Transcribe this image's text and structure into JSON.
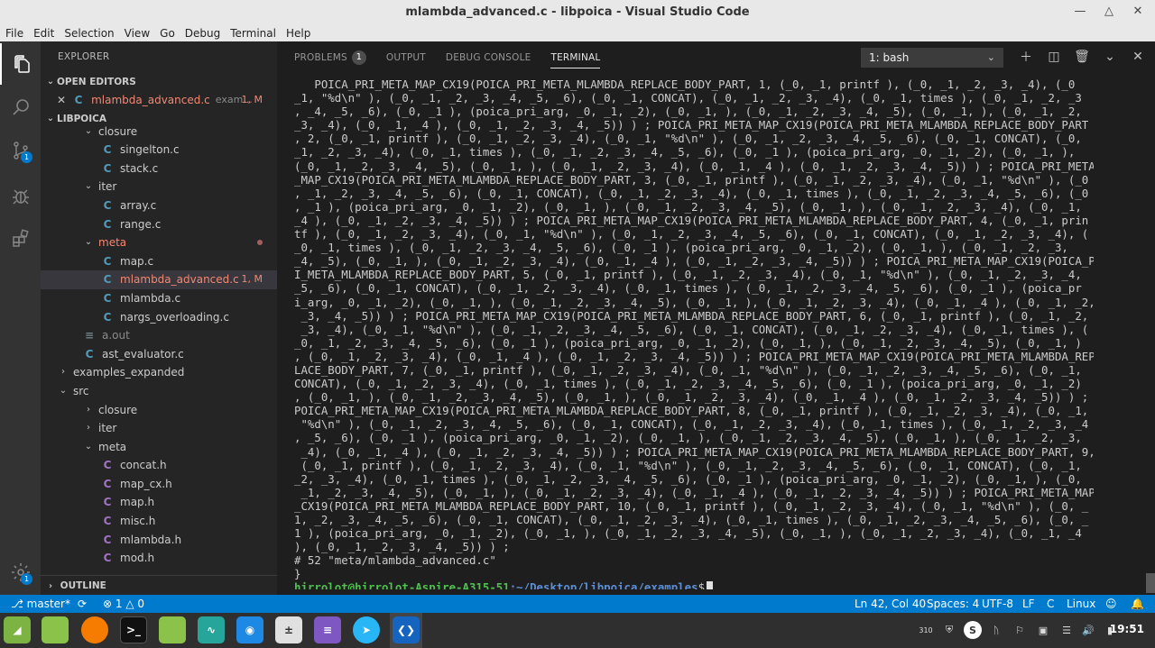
{
  "window": {
    "title": "mlambda_advanced.c - libpoica - Visual Studio Code"
  },
  "menu": [
    "File",
    "Edit",
    "Selection",
    "View",
    "Go",
    "Debug",
    "Terminal",
    "Help"
  ],
  "activity": {
    "scm_badge": "1",
    "settings_badge": "1"
  },
  "sidebar": {
    "title": "EXPLORER",
    "open_editors": "OPEN EDITORS",
    "open_file": {
      "icon": "C",
      "name": "mlambda_advanced.c",
      "folder": "exam...",
      "status": "1, M"
    },
    "workspace": "LIBPOICA",
    "outline": "OUTLINE",
    "tree": [
      {
        "depth": 2,
        "type": "folder",
        "open": true,
        "name": "closure"
      },
      {
        "depth": 3,
        "type": "c",
        "name": "singelton.c"
      },
      {
        "depth": 3,
        "type": "c",
        "name": "stack.c"
      },
      {
        "depth": 2,
        "type": "folder",
        "open": true,
        "name": "iter"
      },
      {
        "depth": 3,
        "type": "c",
        "name": "array.c"
      },
      {
        "depth": 3,
        "type": "c",
        "name": "range.c"
      },
      {
        "depth": 2,
        "type": "folder",
        "open": true,
        "name": "meta",
        "style": "err",
        "dot": true
      },
      {
        "depth": 3,
        "type": "c",
        "name": "map.c"
      },
      {
        "depth": 3,
        "type": "c",
        "name": "mlambda_advanced.c",
        "style": "err",
        "status": "1, M",
        "selected": true
      },
      {
        "depth": 3,
        "type": "c",
        "name": "mlambda.c"
      },
      {
        "depth": 3,
        "type": "c",
        "name": "nargs_overloading.c"
      },
      {
        "depth": 2,
        "type": "other",
        "name": "a.out",
        "style": "dim"
      },
      {
        "depth": 2,
        "type": "c",
        "name": "ast_evaluator.c"
      },
      {
        "depth": 1,
        "type": "folder",
        "open": false,
        "name": "examples_expanded"
      },
      {
        "depth": 1,
        "type": "folder",
        "open": true,
        "name": "src"
      },
      {
        "depth": 2,
        "type": "folder",
        "open": false,
        "name": "closure"
      },
      {
        "depth": 2,
        "type": "folder",
        "open": false,
        "name": "iter"
      },
      {
        "depth": 2,
        "type": "folder",
        "open": true,
        "name": "meta"
      },
      {
        "depth": 3,
        "type": "h",
        "name": "concat.h"
      },
      {
        "depth": 3,
        "type": "h",
        "name": "map_cx.h"
      },
      {
        "depth": 3,
        "type": "h",
        "name": "map.h"
      },
      {
        "depth": 3,
        "type": "h",
        "name": "misc.h"
      },
      {
        "depth": 3,
        "type": "h",
        "name": "mlambda.h"
      },
      {
        "depth": 3,
        "type": "h",
        "name": "mod.h"
      }
    ]
  },
  "panel": {
    "tabs": [
      "PROBLEMS",
      "OUTPUT",
      "DEBUG CONSOLE",
      "TERMINAL"
    ],
    "problems_count": "1",
    "terminal_select": "1: bash",
    "terminal_lines": [
      "   POICA_PRI_META_MAP_CX19(POICA_PRI_META_MLAMBDA_REPLACE_BODY_PART, 1, (_0, _1, printf ), (_0, _1, _2, _3, _4), (_0",
      "_1, \"%d\\n\" ), (_0, _1, _2, _3, _4, _5, _6), (_0, _1, CONCAT), (_0, _1, _2, _3, _4), (_0, _1, times ), (_0, _1, _2, _3",
      ", _4, _5, _6), (_0, _1 ), (poica_pri_arg, _0, _1, _2), (_0, _1, ), (_0, _1, _2, _3, _4, _5), (_0, _1, ), (_0, _1, _2,",
      "_3, _4), (_0, _1, _4 ), (_0, _1, _2, _3, _4, _5)) ) ; POICA_PRI_META_MAP_CX19(POICA_PRI_META_MLAMBDA_REPLACE_BODY_PART",
      ", 2, (_0, _1, printf ), (_0, _1, _2, _3, _4), (_0, _1, \"%d\\n\" ), (_0, _1, _2, _3, _4, _5, _6), (_0, _1, CONCAT), (_0,",
      "_1, _2, _3, _4), (_0, _1, times ), (_0, _1, _2, _3, _4, _5, _6), (_0, _1 ), (poica_pri_arg, _0, _1, _2), (_0, _1, ),",
      "(_0, _1, _2, _3, _4, _5), (_0, _1, ), (_0, _1, _2, _3, _4), (_0, _1, _4 ), (_0, _1, _2, _3, _4, _5)) ) ; POICA_PRI_META",
      "_MAP_CX19(POICA_PRI_META_MLAMBDA_REPLACE_BODY_PART, 3, (_0, _1, printf ), (_0, _1, _2, _3, _4), (_0, _1, \"%d\\n\" ), (_0",
      ", _1, _2, _3, _4, _5, _6), (_0, _1, CONCAT), (_0, _1, _2, _3, _4), (_0, _1, times ), (_0, _1, _2, _3, _4, _5, _6), (_0",
      ", _1 ), (poica_pri_arg, _0, _1, _2), (_0, _1, ), (_0, _1, _2, _3, _4, _5), (_0, _1, ), (_0, _1, _2, _3, _4), (_0, _1,",
      "_4 ), (_0, _1, _2, _3, _4, _5)) ) ; POICA_PRI_META_MAP_CX19(POICA_PRI_META_MLAMBDA_REPLACE_BODY_PART, 4, (_0, _1, prin",
      "tf ), (_0, _1, _2, _3, _4), (_0, _1, \"%d\\n\" ), (_0, _1, _2, _3, _4, _5, _6), (_0, _1, CONCAT), (_0, _1, _2, _3, _4), (",
      "_0, _1, times ), (_0, _1, _2, _3, _4, _5, _6), (_0, _1 ), (poica_pri_arg, _0, _1, _2), (_0, _1, ), (_0, _1, _2, _3,",
      "_4, _5), (_0, _1, ), (_0, _1, _2, _3, _4), (_0, _1, _4 ), (_0, _1, _2, _3, _4, _5)) ) ; POICA_PRI_META_MAP_CX19(POICA_PR",
      "I_META_MLAMBDA_REPLACE_BODY_PART, 5, (_0, _1, printf ), (_0, _1, _2, _3, _4), (_0, _1, \"%d\\n\" ), (_0, _1, _2, _3, _4,",
      "_5, _6), (_0, _1, CONCAT), (_0, _1, _2, _3, _4), (_0, _1, times ), (_0, _1, _2, _3, _4, _5, _6), (_0, _1 ), (poica_pr",
      "i_arg, _0, _1, _2), (_0, _1, ), (_0, _1, _2, _3, _4, _5), (_0, _1, ), (_0, _1, _2, _3, _4), (_0, _1, _4 ), (_0, _1, _2,",
      " _3, _4, _5)) ) ; POICA_PRI_META_MAP_CX19(POICA_PRI_META_MLAMBDA_REPLACE_BODY_PART, 6, (_0, _1, printf ), (_0, _1, _2,",
      " _3, _4), (_0, _1, \"%d\\n\" ), (_0, _1, _2, _3, _4, _5, _6), (_0, _1, CONCAT), (_0, _1, _2, _3, _4), (_0, _1, times ), (",
      "_0, _1, _2, _3, _4, _5, _6), (_0, _1 ), (poica_pri_arg, _0, _1, _2), (_0, _1, ), (_0, _1, _2, _3, _4, _5), (_0, _1, )",
      ", (_0, _1, _2, _3, _4), (_0, _1, _4 ), (_0, _1, _2, _3, _4, _5)) ) ; POICA_PRI_META_MAP_CX19(POICA_PRI_META_MLAMBDA_REP",
      "LACE_BODY_PART, 7, (_0, _1, printf ), (_0, _1, _2, _3, _4), (_0, _1, \"%d\\n\" ), (_0, _1, _2, _3, _4, _5, _6), (_0, _1,",
      "CONCAT), (_0, _1, _2, _3, _4), (_0, _1, times ), (_0, _1, _2, _3, _4, _5, _6), (_0, _1 ), (poica_pri_arg, _0, _1, _2)",
      ", (_0, _1, ), (_0, _1, _2, _3, _4, _5), (_0, _1, ), (_0, _1, _2, _3, _4), (_0, _1, _4 ), (_0, _1, _2, _3, _4, _5)) ) ;",
      "POICA_PRI_META_MAP_CX19(POICA_PRI_META_MLAMBDA_REPLACE_BODY_PART, 8, (_0, _1, printf ), (_0, _1, _2, _3, _4), (_0, _1,",
      " \"%d\\n\" ), (_0, _1, _2, _3, _4, _5, _6), (_0, _1, CONCAT), (_0, _1, _2, _3, _4), (_0, _1, times ), (_0, _1, _2, _3, _4",
      ", _5, _6), (_0, _1 ), (poica_pri_arg, _0, _1, _2), (_0, _1, ), (_0, _1, _2, _3, _4, _5), (_0, _1, ), (_0, _1, _2, _3,",
      " _4), (_0, _1, _4 ), (_0, _1, _2, _3, _4, _5)) ) ; POICA_PRI_META_MAP_CX19(POICA_PRI_META_MLAMBDA_REPLACE_BODY_PART, 9,",
      " (_0, _1, printf ), (_0, _1, _2, _3, _4), (_0, _1, \"%d\\n\" ), (_0, _1, _2, _3, _4, _5, _6), (_0, _1, CONCAT), (_0, _1,",
      "_2, _3, _4), (_0, _1, times ), (_0, _1, _2, _3, _4, _5, _6), (_0, _1 ), (poica_pri_arg, _0, _1, _2), (_0, _1, ), (_0,",
      " _1, _2, _3, _4, _5), (_0, _1, ), (_0, _1, _2, _3, _4), (_0, _1, _4 ), (_0, _1, _2, _3, _4, _5)) ) ; POICA_PRI_META_MAP",
      "_CX19(POICA_PRI_META_MLAMBDA_REPLACE_BODY_PART, 10, (_0, _1, printf ), (_0, _1, _2, _3, _4), (_0, _1, \"%d\\n\" ), (_0, _",
      "1, _2, _3, _4, _5, _6), (_0, _1, CONCAT), (_0, _1, _2, _3, _4), (_0, _1, times ), (_0, _1, _2, _3, _4, _5, _6), (_0, _",
      "1 ), (poica_pri_arg, _0, _1, _2), (_0, _1, ), (_0, _1, _2, _3, _4, _5), (_0, _1, ), (_0, _1, _2, _3, _4), (_0, _1, _4",
      "), (_0, _1, _2, _3, _4, _5)) ) ;",
      "# 52 \"meta/mlambda_advanced.c\"",
      "}"
    ],
    "prompt_user": "hirrolot@hirrolot-Aspire-A315-51",
    "prompt_path": ":~/Desktop/libpoica/examples",
    "prompt_symbol": "$"
  },
  "statusbar": {
    "branch": "master*",
    "errors": "1",
    "warnings": "0",
    "position": "Ln 42, Col 40",
    "spaces": "Spaces: 4",
    "encoding": "UTF-8",
    "eol": "LF",
    "language": "C",
    "platform": "Linux"
  },
  "taskbar": {
    "clock": "19:51",
    "tray_badge": "310"
  }
}
